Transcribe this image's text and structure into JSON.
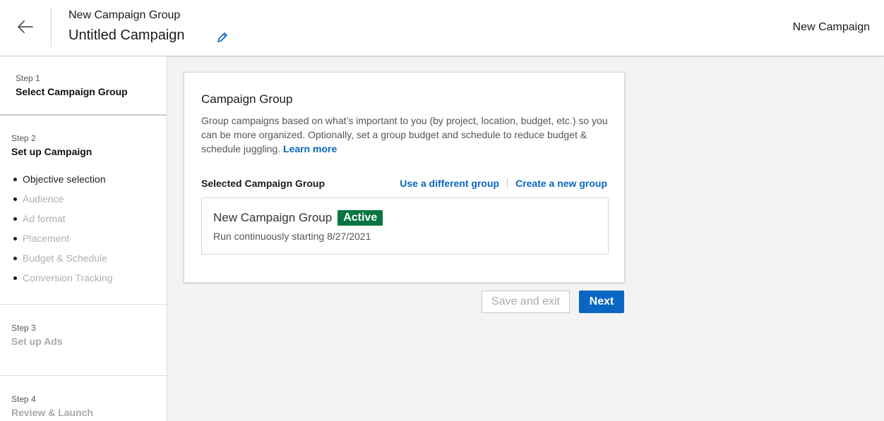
{
  "header": {
    "group_name": "New Campaign Group",
    "campaign_name": "Untitled Campaign",
    "right_label": "New Campaign",
    "back_icon": "arrow-left-icon",
    "edit_icon": "pencil-icon"
  },
  "sidebar": {
    "step1": {
      "num": "Step 1",
      "title": "Select Campaign Group"
    },
    "step2": {
      "num": "Step 2",
      "title": "Set up Campaign",
      "substeps": [
        {
          "label": "Objective selection",
          "active": true
        },
        {
          "label": "Audience",
          "active": false
        },
        {
          "label": "Ad format",
          "active": false
        },
        {
          "label": "Placement",
          "active": false
        },
        {
          "label": "Budget & Schedule",
          "active": false
        },
        {
          "label": "Conversion Tracking",
          "active": false
        }
      ]
    },
    "step3": {
      "num": "Step 3",
      "title": "Set up Ads"
    },
    "step4": {
      "num": "Step 4",
      "title": "Review & Launch"
    }
  },
  "card": {
    "title": "Campaign Group",
    "description": "Group campaigns based on what’s important to you (by project, location, budget, etc.) so you can be more organized. Optionally, set a group budget and schedule to reduce budget & schedule juggling.",
    "learn_more": "Learn more",
    "selected_label": "Selected Campaign Group",
    "use_different": "Use a different group",
    "create_new": "Create a new group",
    "group": {
      "name": "New Campaign Group",
      "status": "Active",
      "schedule": "Run continuously starting 8/27/2021"
    }
  },
  "actions": {
    "save_exit": "Save and exit",
    "next": "Next"
  },
  "colors": {
    "accent": "#0a66c2",
    "active_badge": "#057642"
  }
}
